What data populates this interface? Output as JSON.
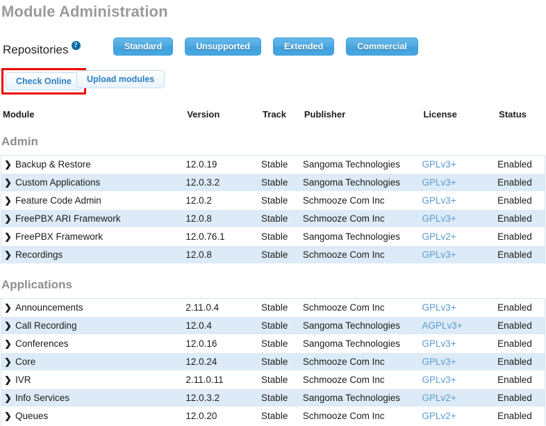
{
  "page": {
    "title": "Module Administration"
  },
  "repositories": {
    "label": "Repositories",
    "help_icon": "question-mark-help-icon",
    "buttons": [
      {
        "label": "Standard"
      },
      {
        "label": "Unsupported"
      },
      {
        "label": "Extended"
      },
      {
        "label": "Commercial"
      }
    ]
  },
  "actions": {
    "check_online_label": "Check Online",
    "upload_modules_label": "Upload modules",
    "highlight_color": "#ee0000"
  },
  "table": {
    "headers": {
      "module": "Module",
      "version": "Version",
      "track": "Track",
      "publisher": "Publisher",
      "license": "License",
      "status": "Status"
    },
    "chevron_glyph": "❯",
    "sections": [
      {
        "title": "Admin",
        "rows": [
          {
            "module": "Backup & Restore",
            "version": "12.0.19",
            "track": "Stable",
            "publisher": "Sangoma Technologies",
            "license": "GPLv3+",
            "status": "Enabled"
          },
          {
            "module": "Custom Applications",
            "version": "12.0.3.2",
            "track": "Stable",
            "publisher": "Sangoma Technologies",
            "license": "GPLv3+",
            "status": "Enabled"
          },
          {
            "module": "Feature Code Admin",
            "version": "12.0.2",
            "track": "Stable",
            "publisher": "Schmooze Com Inc",
            "license": "GPLv3+",
            "status": "Enabled"
          },
          {
            "module": "FreePBX ARI Framework",
            "version": "12.0.8",
            "track": "Stable",
            "publisher": "Schmooze Com Inc",
            "license": "GPLv3+",
            "status": "Enabled"
          },
          {
            "module": "FreePBX Framework",
            "version": "12.0.76.1",
            "track": "Stable",
            "publisher": "Sangoma Technologies",
            "license": "GPLv2+",
            "status": "Enabled"
          },
          {
            "module": "Recordings",
            "version": "12.0.8",
            "track": "Stable",
            "publisher": "Schmooze Com Inc",
            "license": "GPLv3+",
            "status": "Enabled"
          }
        ]
      },
      {
        "title": "Applications",
        "rows": [
          {
            "module": "Announcements",
            "version": "2.11.0.4",
            "track": "Stable",
            "publisher": "Schmooze Com Inc",
            "license": "GPLv3+",
            "status": "Enabled"
          },
          {
            "module": "Call Recording",
            "version": "12.0.4",
            "track": "Stable",
            "publisher": "Sangoma Technologies",
            "license": "AGPLv3+",
            "status": "Enabled"
          },
          {
            "module": "Conferences",
            "version": "12.0.16",
            "track": "Stable",
            "publisher": "Sangoma Technologies",
            "license": "GPLv3+",
            "status": "Enabled"
          },
          {
            "module": "Core",
            "version": "12.0.24",
            "track": "Stable",
            "publisher": "Schmooze Com Inc",
            "license": "GPLv3+",
            "status": "Enabled"
          },
          {
            "module": "IVR",
            "version": "2.11.0.11",
            "track": "Stable",
            "publisher": "Schmooze Com Inc",
            "license": "GPLv3+",
            "status": "Enabled"
          },
          {
            "module": "Info Services",
            "version": "12.0.3.2",
            "track": "Stable",
            "publisher": "Sangoma Technologies",
            "license": "GPLv2+",
            "status": "Enabled"
          },
          {
            "module": "Queues",
            "version": "12.0.20",
            "track": "Stable",
            "publisher": "Schmooze Com Inc",
            "license": "GPLv2+",
            "status": "Enabled"
          }
        ]
      }
    ]
  }
}
